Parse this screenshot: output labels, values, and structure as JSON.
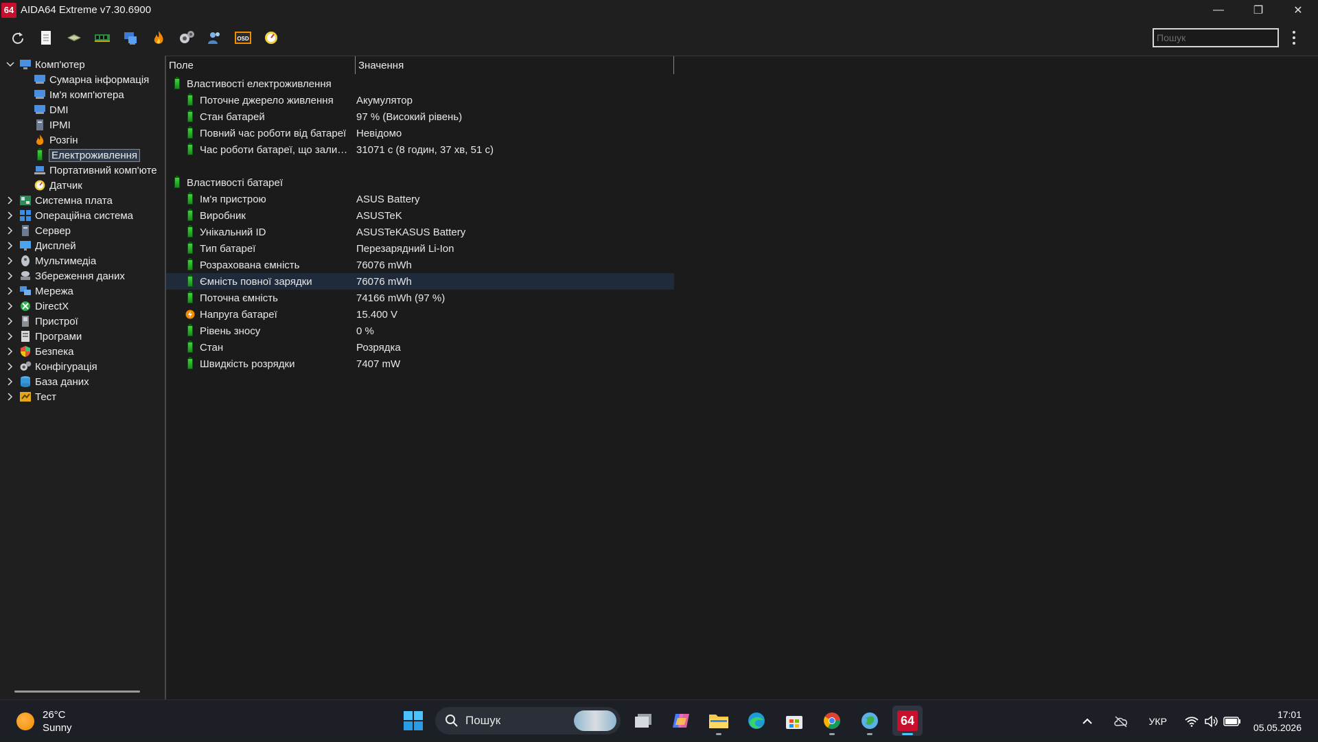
{
  "window": {
    "title": "AIDA64 Extreme v7.30.6900",
    "logo_text": "64",
    "minimize": "—",
    "restore": "❐",
    "close": "✕"
  },
  "toolbar": {
    "search_placeholder": "Пошук",
    "buttons": [
      "refresh-icon",
      "report-icon",
      "motherboard-icon",
      "memory-icon",
      "computer-network-icon",
      "flame-icon",
      "settings-gears-icon",
      "users-icon",
      "osd-icon",
      "sensor-gauge-icon"
    ],
    "osd_label": "OSD"
  },
  "sidebar": {
    "root": {
      "label": "Комп'ютер",
      "expanded": true
    },
    "children": [
      {
        "label": "Сумарна інформація",
        "icon": "computer-icon"
      },
      {
        "label": "Ім'я комп'ютера",
        "icon": "computer-icon"
      },
      {
        "label": "DMI",
        "icon": "computer-icon"
      },
      {
        "label": "IPMI",
        "icon": "server-icon"
      },
      {
        "label": "Розгін",
        "icon": "flame-icon"
      },
      {
        "label": "Електроживлення",
        "icon": "battery-icon",
        "selected": true
      },
      {
        "label": "Портативний комп'юте",
        "icon": "laptop-icon"
      },
      {
        "label": "Датчик",
        "icon": "sensor-gauge-icon"
      }
    ],
    "categories": [
      {
        "label": "Системна плата",
        "icon": "motherboard-icon"
      },
      {
        "label": "Операційна система",
        "icon": "windows-icon"
      },
      {
        "label": "Сервер",
        "icon": "server-icon"
      },
      {
        "label": "Дисплей",
        "icon": "display-icon"
      },
      {
        "label": "Мультимедіа",
        "icon": "multimedia-icon"
      },
      {
        "label": "Збереження даних",
        "icon": "storage-icon"
      },
      {
        "label": "Мережа",
        "icon": "network-icon"
      },
      {
        "label": "DirectX",
        "icon": "directx-icon"
      },
      {
        "label": "Пристрої",
        "icon": "devices-icon"
      },
      {
        "label": "Програми",
        "icon": "programs-icon"
      },
      {
        "label": "Безпека",
        "icon": "security-shield-icon"
      },
      {
        "label": "Конфігурація",
        "icon": "configuration-icon"
      },
      {
        "label": "База даних",
        "icon": "database-icon"
      },
      {
        "label": "Тест",
        "icon": "benchmark-icon"
      }
    ]
  },
  "table": {
    "headers": {
      "field": "Поле",
      "value": "Значення"
    },
    "groups": [
      {
        "title": "Властивості електроживлення",
        "rows": [
          {
            "field": "Поточне джерело живлення",
            "value": "Акумулятор"
          },
          {
            "field": "Стан батарей",
            "value": "97 % (Високий рівень)"
          },
          {
            "field": "Повний час роботи від батареї",
            "value": "Невідомо"
          },
          {
            "field": "Час роботи батареї, що залиш...",
            "value": "31071 с (8 годин, 37 хв, 51 с)"
          }
        ]
      },
      {
        "title": "Властивості батареї",
        "rows": [
          {
            "field": "Ім'я пристрою",
            "value": "ASUS Battery"
          },
          {
            "field": "Виробник",
            "value": "ASUSTeK"
          },
          {
            "field": "Унікальний ID",
            "value": "ASUSTeKASUS Battery"
          },
          {
            "field": "Тип батареї",
            "value": "Перезарядний Li-Ion"
          },
          {
            "field": "Розрахована ємність",
            "value": "76076 mWh"
          },
          {
            "field": "Ємність повної зарядки",
            "value": "76076 mWh",
            "highlight": true
          },
          {
            "field": "Поточна ємність",
            "value": "74166 mWh  (97 %)"
          },
          {
            "field": "Напруга батареї",
            "value": "15.400 V",
            "icon": "voltage-icon"
          },
          {
            "field": "Рівень зносу",
            "value": "0 %"
          },
          {
            "field": "Стан",
            "value": "Розрядка"
          },
          {
            "field": "Швидкість розрядки",
            "value": "7407 mW"
          }
        ]
      }
    ]
  },
  "taskbar": {
    "weather": {
      "temp": "26°C",
      "condition": "Sunny"
    },
    "search_placeholder": "Пошук",
    "apps": [
      "task-view-icon",
      "copilot-icon",
      "file-explorer-icon",
      "edge-icon",
      "store-icon",
      "chrome-icon",
      "globe-app-icon",
      "aida64-icon"
    ],
    "aida_label": "64",
    "language": "УКР",
    "time": "17:01",
    "date": "05.05.2026"
  },
  "colors": {
    "accent_red": "#c8102e",
    "battery_green": "#2fb82f",
    "highlight_row": "#1f2a3b",
    "taskbar_active": "#4cc2ff"
  }
}
